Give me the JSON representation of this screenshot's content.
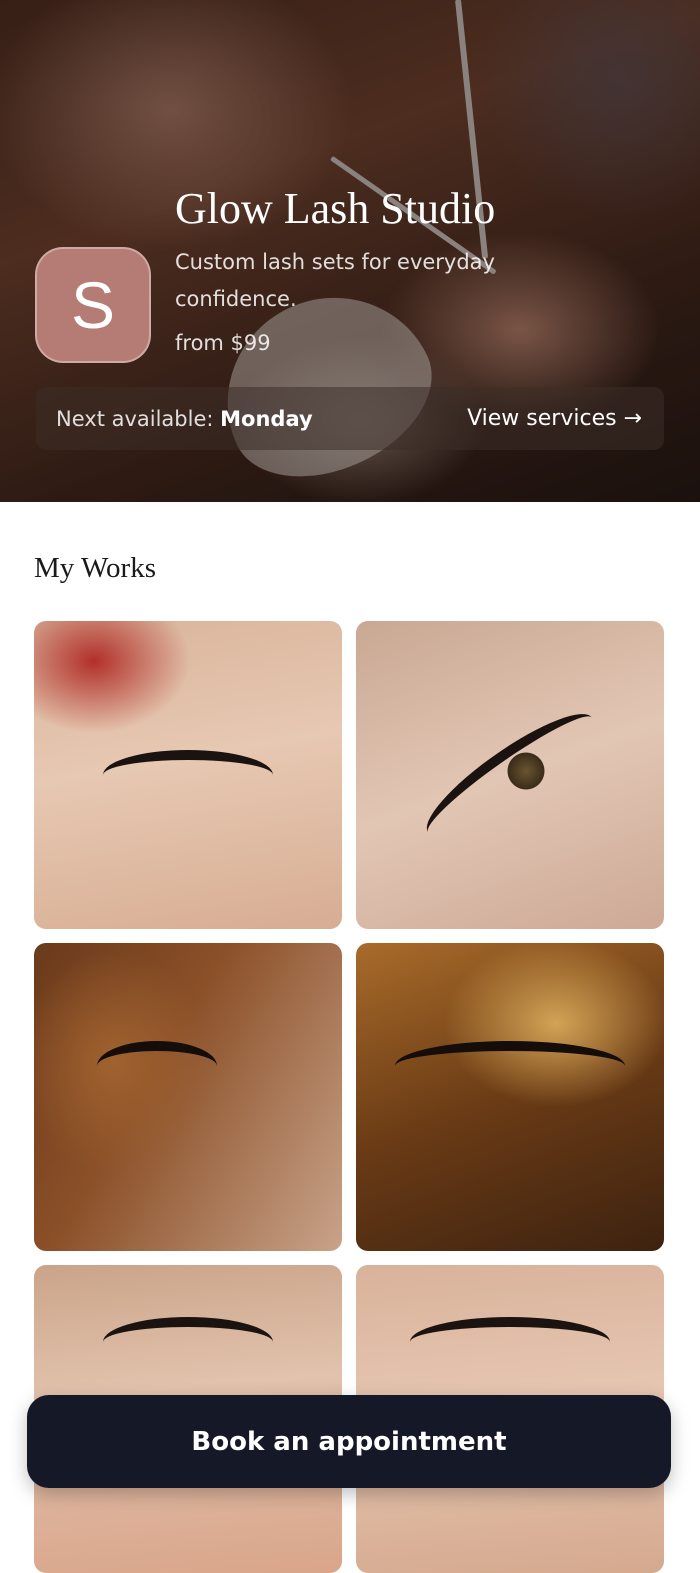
{
  "hero": {
    "avatar_letter": "S",
    "studio_name": "Glow Lash Studio",
    "tagline": "Custom lash sets for everyday confidence.",
    "price": "from $99",
    "availability_label": "Next available:",
    "availability_day": "Monday",
    "view_services_label": "View services →"
  },
  "works": {
    "title": "My Works"
  },
  "cta": {
    "book_label": "Book an appointment"
  },
  "colors": {
    "avatar_bg": "#b47c75",
    "cta_bg": "#151827",
    "text_dark": "#1a1a1a"
  }
}
